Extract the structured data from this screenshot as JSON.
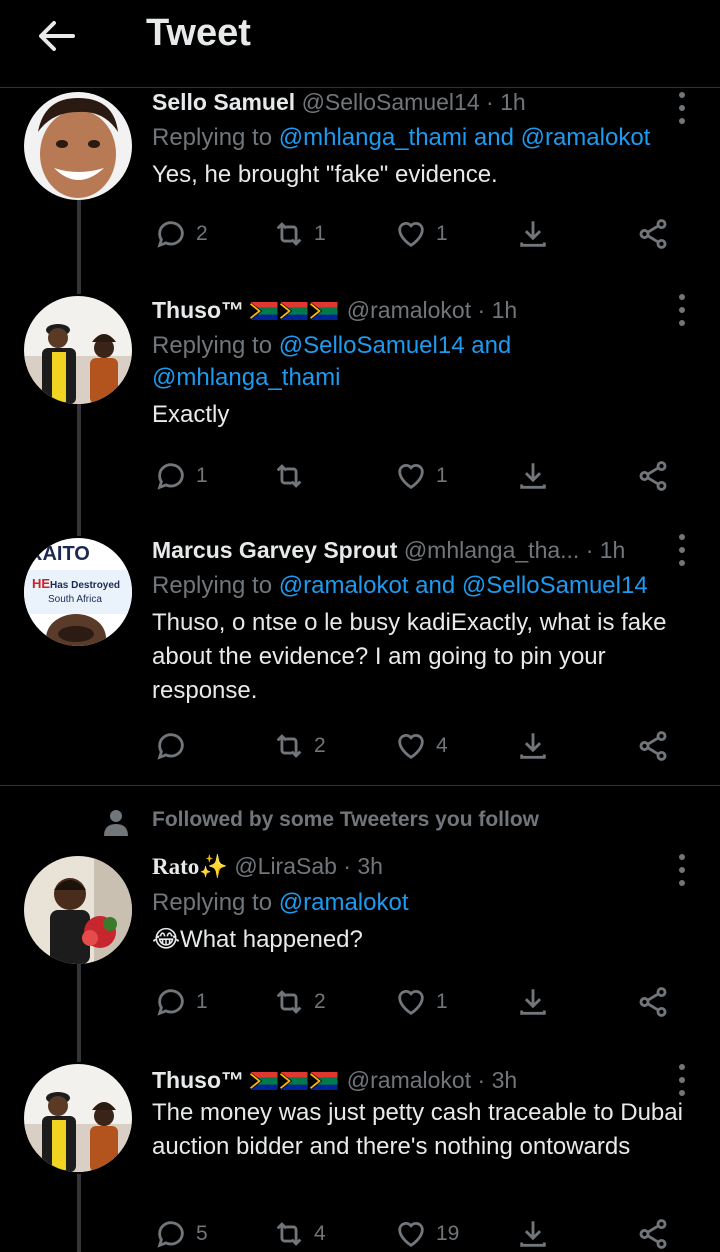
{
  "header": {
    "title": "Tweet"
  },
  "tweets": [
    {
      "name": "Sello Samuel",
      "handle": "@SelloSamuel14",
      "time": "· 1h",
      "replying_prefix": "Replying to",
      "replying_to": "@mhlanga_thami and @ramalokot",
      "text": "Yes, he brought \"fake\" evidence.",
      "counts": {
        "reply": "2",
        "retweet": "1",
        "like": "1"
      }
    },
    {
      "name": "Thuso™",
      "handle": "@ramalokot",
      "time": "· 1h",
      "replying_prefix": "Replying to",
      "replying_to": "@SelloSamuel14 and @mhlanga_thami",
      "text": "Exactly",
      "counts": {
        "reply": "1",
        "retweet": "",
        "like": "1"
      }
    },
    {
      "name": "Marcus Garvey Sprout",
      "handle": "@mhlanga_tha...",
      "time": "· 1h",
      "replying_prefix": "Replying to",
      "replying_to": "@ramalokot and @SelloSamuel14",
      "text": "Thuso, o ntse o le busy kadiExactly, what is fake about the evidence? I am going to pin your response.",
      "counts": {
        "reply": "",
        "retweet": "2",
        "like": "4"
      },
      "avatar_text": {
        "top": "RAITO",
        "red": "HE",
        "mid": "Has Destroyed",
        "bottom": "South Africa"
      }
    },
    {
      "name": "Rato",
      "handle": "@LiraSab",
      "time": "· 3h",
      "replying_prefix": "Replying to",
      "replying_to": "@ramalokot",
      "text": "😂What happened?",
      "counts": {
        "reply": "1",
        "retweet": "2",
        "like": "1"
      }
    },
    {
      "name": "Thuso™",
      "handle": "@ramalokot",
      "time": "· 3h",
      "text": "The money was just petty cash traceable to Dubai auction bidder and there's nothing ontowards",
      "counts": {
        "reply": "5",
        "retweet": "4",
        "like": "19"
      }
    }
  ],
  "social_context": {
    "text": "Followed by some Tweeters you follow"
  },
  "icons": [
    "back-arrow-icon",
    "more-icon",
    "reply-icon",
    "retweet-icon",
    "like-icon",
    "bookmark-icon",
    "share-icon",
    "person-icon",
    "sa-flag-icon",
    "sparkles-emoji-icon"
  ],
  "colors": {
    "background": "#000000",
    "text": "#e7e9ea",
    "muted": "#71767b",
    "link": "#1d9bf0"
  }
}
